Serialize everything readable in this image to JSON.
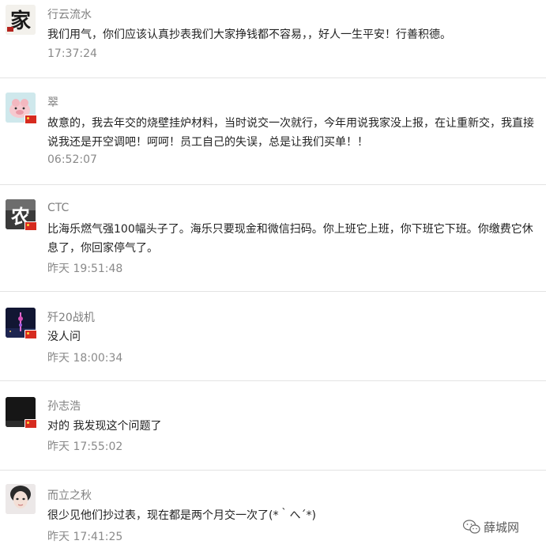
{
  "comments": [
    {
      "nickname": "行云流水",
      "avatar_icon": "calligraphy-avatar-icon",
      "avatar_char": "家",
      "content": "我们用气，你们应该认真抄表我们大家挣钱都不容易，，好人一生平安！行善积德。",
      "time": "17:37:24"
    },
    {
      "nickname": "翠",
      "avatar_icon": "pig-avatar-icon",
      "content": "故意的，我去年交的烧壁挂炉材料，当时说交一次就行，今年用说我家没上报，在让重新交，我直接说我还是开空调吧！呵呵！员工自己的失误，总是让我们买单！！",
      "time": "06:52:07"
    },
    {
      "nickname": "CTC",
      "avatar_icon": "calligraphy-avatar-icon",
      "avatar_char": "农",
      "content": "比海乐燃气强100幅头子了。海乐只要现金和微信扫码。你上班它上班，你下班它下班。你缴费它休息了，你回家停气了。",
      "time": "昨天 19:51:48"
    },
    {
      "nickname": "歼20战机",
      "avatar_icon": "night-tower-avatar-icon",
      "content": "没人问",
      "time": "昨天 18:00:34"
    },
    {
      "nickname": "孙志浩",
      "avatar_icon": "dark-avatar-icon",
      "content": "对的 我发现这个问题了",
      "time": "昨天 17:55:02"
    },
    {
      "nickname": "而立之秋",
      "avatar_icon": "portrait-avatar-icon",
      "content": "很少见他们抄过表，现在都是两个月交一次了(*｀へ´*)",
      "time": "昨天 17:41:25"
    }
  ],
  "watermark": {
    "text": "薛城网",
    "icon": "wechat-icon"
  },
  "colors": {
    "nickname": "#7f7f7f",
    "content": "#222222",
    "time": "#8a8a8a",
    "divider": "#e3e3e3",
    "flag": "#d62b1f"
  }
}
